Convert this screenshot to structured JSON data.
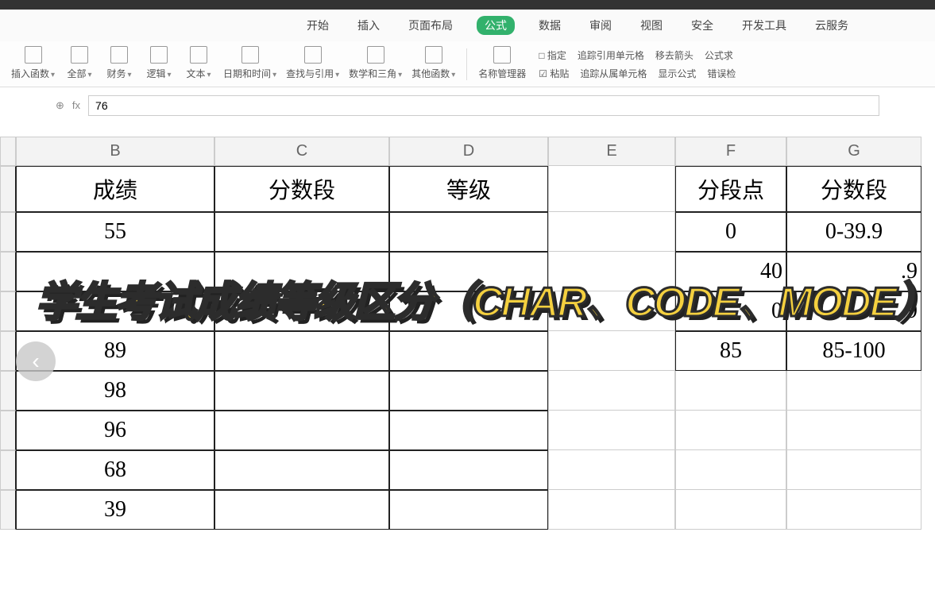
{
  "menu": {
    "tabs": [
      "开始",
      "插入",
      "页面布局",
      "公式",
      "数据",
      "审阅",
      "视图",
      "安全",
      "开发工具",
      "云服务"
    ],
    "activeIndex": 3
  },
  "ribbon": {
    "groups": [
      {
        "label": "插入函数"
      },
      {
        "label": "全部"
      },
      {
        "label": "财务"
      },
      {
        "label": "逻辑"
      },
      {
        "label": "文本"
      },
      {
        "label": "日期和时间"
      },
      {
        "label": "查找与引用"
      },
      {
        "label": "数学和三角"
      },
      {
        "label": "其他函数"
      },
      {
        "label": "名称管理器"
      }
    ],
    "right": {
      "row1": [
        "□ 指定",
        "追踪引用单元格",
        "移去箭头",
        "公式求"
      ],
      "row2": [
        "☑ 粘贴",
        "追踪从属单元格",
        "显示公式",
        "错误检"
      ]
    }
  },
  "formula_bar": {
    "value": "76"
  },
  "columns": [
    "",
    "B",
    "C",
    "D",
    "E",
    "F",
    "G"
  ],
  "header_row": {
    "B": "成绩",
    "C": "分数段",
    "D": "等级",
    "E": "",
    "F": "分段点",
    "G": "分数段"
  },
  "rows": [
    {
      "B": "55",
      "C": "",
      "D": "",
      "E": "",
      "F": "0",
      "G": "0-39.9"
    },
    {
      "B": "",
      "C": "",
      "D": "",
      "E": "",
      "F": "40",
      "G": ".9"
    },
    {
      "B": "",
      "C": "",
      "D": "",
      "E": "",
      "F": "0",
      "G": ".9"
    },
    {
      "B": "89",
      "C": "",
      "D": "",
      "E": "",
      "F": "85",
      "G": "85-100"
    },
    {
      "B": "98",
      "C": "",
      "D": "",
      "E": "",
      "F": "",
      "G": ""
    },
    {
      "B": "96",
      "C": "",
      "D": "",
      "E": "",
      "F": "",
      "G": ""
    },
    {
      "B": "68",
      "C": "",
      "D": "",
      "E": "",
      "F": "",
      "G": ""
    },
    {
      "B": "39",
      "C": "",
      "D": "",
      "E": "",
      "F": "",
      "G": ""
    }
  ],
  "overlay": {
    "title": "学生考试成绩等级区分（CHAR、CODE、MODE）"
  },
  "back_button": "‹"
}
